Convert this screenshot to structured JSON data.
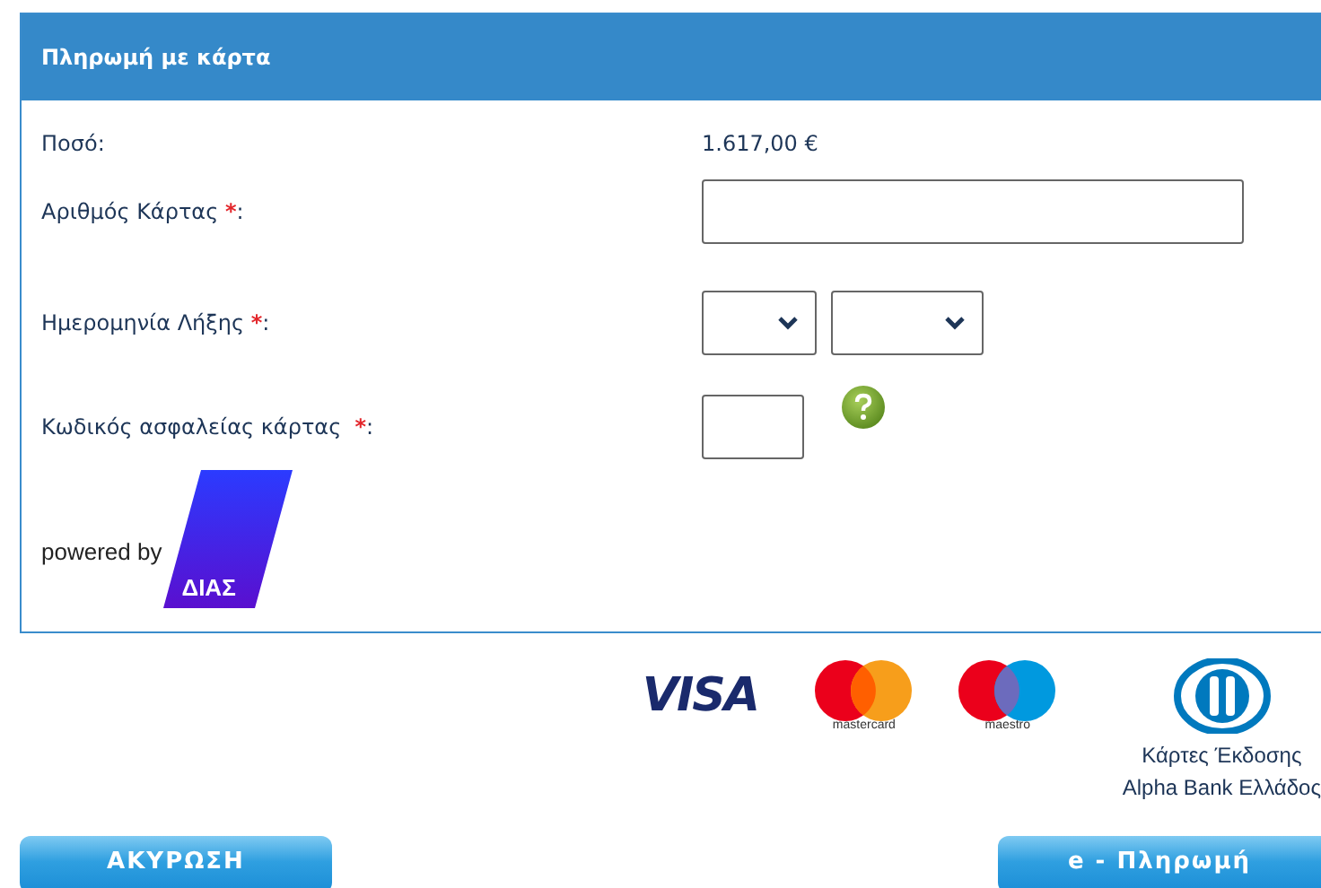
{
  "panel": {
    "title": "Πληρωμή με κάρτα",
    "rows": [
      {
        "kind": "amount",
        "label": "Ποσό:",
        "value": "1.617,00 €"
      },
      {
        "kind": "card-input",
        "label": "Αριθμός Κάρτας ",
        "required_mark": "*",
        "colon": ":"
      },
      {
        "kind": "selects",
        "label": "Ημερομηνία Λήξης ",
        "required_mark": "*",
        "colon": ":"
      },
      {
        "kind": "code-input",
        "label": "Κωδικός ασφαλείας κάρτας  ",
        "required_mark": "*",
        "colon": ":"
      }
    ],
    "powered_by": {
      "text": "powered by",
      "logo": "ΔΙΑΣ"
    }
  },
  "card_logos": [
    {
      "kind": "visa",
      "text": "VISA"
    },
    {
      "kind": "mastercard",
      "text": "mastercard"
    },
    {
      "kind": "maestro",
      "text": "maestro"
    },
    {
      "kind": "diners",
      "caption_lines": [
        "Κάρτες Έκδοσης",
        "Alpha Bank Ελλάδος"
      ]
    }
  ],
  "buttons": [
    {
      "label": "ΑΚΥΡΩΣΗ"
    },
    {
      "label": "e - Πληρωμή"
    }
  ]
}
